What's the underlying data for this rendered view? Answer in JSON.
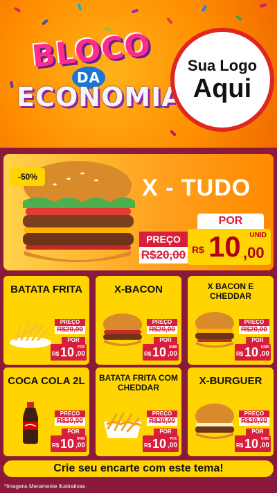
{
  "header": {
    "title_line1": "BLOCO",
    "title_line2": "DA",
    "title_line3": "ECONOMIA",
    "logo_line1": "Sua Logo",
    "logo_line2": "Aqui"
  },
  "hero": {
    "name": "X - TUDO",
    "discount": "-50%",
    "preco_label": "PREÇO",
    "old_price": "R$20,00",
    "por_label": "POR",
    "currency": "R$",
    "new_int": "10",
    "new_dec": ",00",
    "unit": "UNID"
  },
  "products": [
    {
      "name": "BATATA FRITA",
      "unit": "POC",
      "old_price": "R$20,00",
      "new_int": "10",
      "new_dec": ",00",
      "image": "fries-icon"
    },
    {
      "name": "X-BACON",
      "unit": "UNID",
      "old_price": "R$20,00",
      "new_int": "10",
      "new_dec": ",00",
      "image": "burger-icon"
    },
    {
      "name": "X BACON E CHEDDAR",
      "unit": "UNID",
      "old_price": "R$20,00",
      "new_int": "10",
      "new_dec": ",00",
      "image": "cheddar-burger-icon"
    },
    {
      "name": "COCA COLA 2L",
      "unit": "UNID",
      "old_price": "R$20,00",
      "new_int": "10",
      "new_dec": ",00",
      "image": "soda-bottle-icon"
    },
    {
      "name": "BATATA FRITA COM CHEDDAR",
      "unit": "POC",
      "old_price": "R$20,00",
      "new_int": "10",
      "new_dec": ",00",
      "image": "cheddar-fries-icon"
    },
    {
      "name": "X-BURGUER",
      "unit": "UNID",
      "old_price": "R$20,00",
      "new_int": "10",
      "new_dec": ",00",
      "image": "cheeseburger-icon"
    }
  ],
  "labels": {
    "preco": "PREÇO",
    "por": "POR",
    "currency": "R$"
  },
  "footer": {
    "cta": "Crie seu encarte com este tema!",
    "disclaimer": "*Imagens Meramente Ilustrativas"
  },
  "colors": {
    "primary_red": "#d81e3a",
    "yellow": "#ffd400",
    "background": "#8a1a3c",
    "orange": "#ff8f00"
  }
}
